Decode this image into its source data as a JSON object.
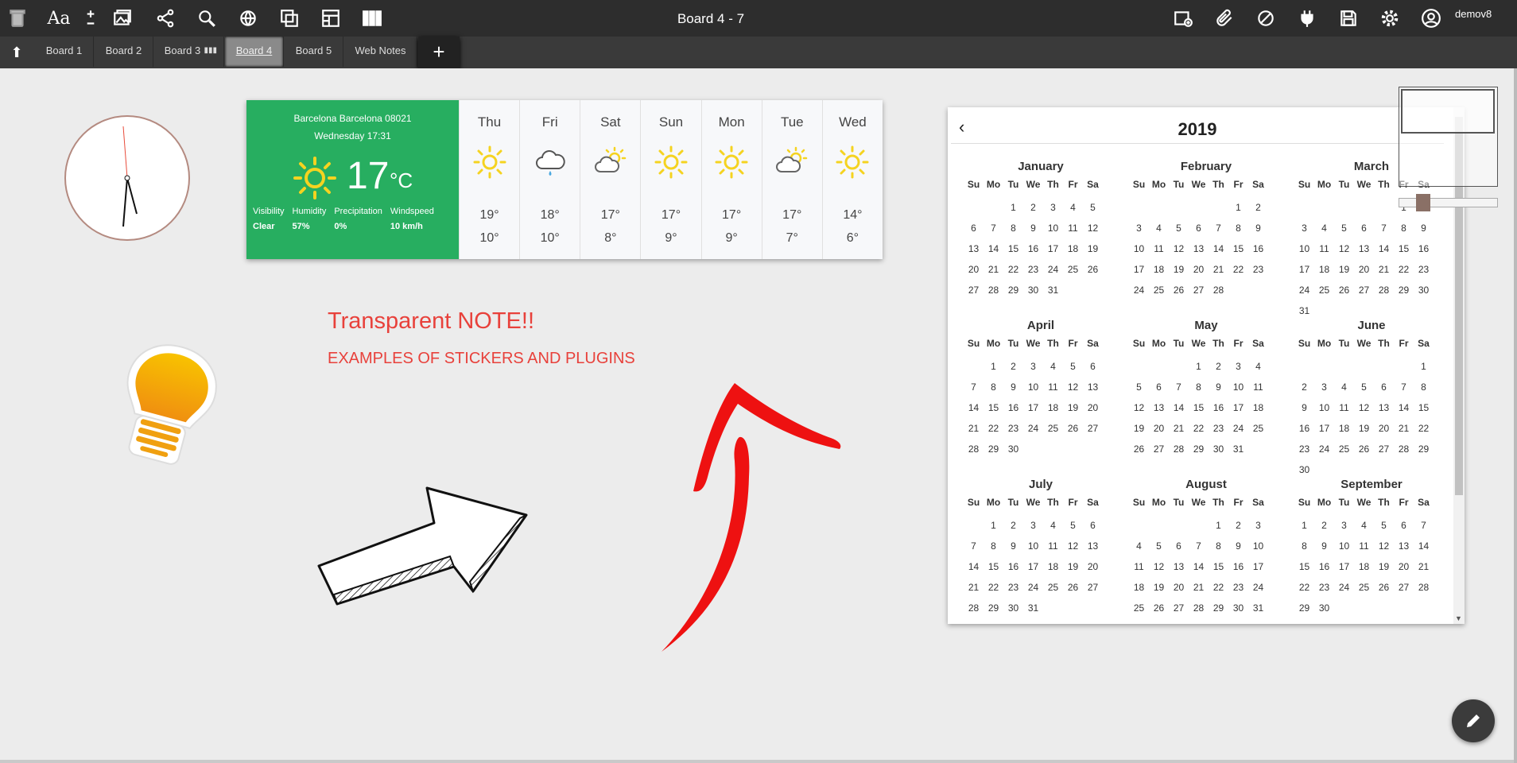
{
  "toolbar": {
    "title": "Board 4 - 7",
    "username": "demov8",
    "font_label": "Aa",
    "left_icons": [
      "trash-icon",
      "font-icon",
      "add-remove-icon",
      "image-icon",
      "share-icon",
      "search-icon",
      "web-icon",
      "windows-icon",
      "layout-icon",
      "columns-icon"
    ],
    "right_icons": [
      "add-note-icon",
      "attach-icon",
      "shape-icon",
      "plugin-icon",
      "save-icon",
      "settings-icon",
      "user-icon"
    ]
  },
  "tabs": [
    {
      "label": "Board 1",
      "active": false
    },
    {
      "label": "Board 2",
      "active": false
    },
    {
      "label": "Board 3",
      "active": false
    },
    {
      "label": "Board 4",
      "active": true
    },
    {
      "label": "Board 5",
      "active": false
    },
    {
      "label": "Web Notes",
      "active": false
    }
  ],
  "tab_add_label": "+",
  "weather": {
    "location": "Barcelona Barcelona 08021",
    "datetime": "Wednesday 17:31",
    "temp": "17",
    "unit": "°C",
    "stats": [
      {
        "label": "Visibility",
        "value": "Clear"
      },
      {
        "label": "Humidity",
        "value": "57%"
      },
      {
        "label": "Precipitation",
        "value": "0%"
      },
      {
        "label": "Windspeed",
        "value": "10 km/h"
      }
    ],
    "forecast": [
      {
        "day": "Thu",
        "icon": "sun",
        "high": "19°",
        "low": "10°"
      },
      {
        "day": "Fri",
        "icon": "rain",
        "high": "18°",
        "low": "10°"
      },
      {
        "day": "Sat",
        "icon": "partly-cloudy",
        "high": "17°",
        "low": "8°"
      },
      {
        "day": "Sun",
        "icon": "sun",
        "high": "17°",
        "low": "9°"
      },
      {
        "day": "Mon",
        "icon": "sun",
        "high": "17°",
        "low": "9°"
      },
      {
        "day": "Tue",
        "icon": "partly-cloudy",
        "high": "17°",
        "low": "7°"
      },
      {
        "day": "Wed",
        "icon": "sun",
        "high": "14°",
        "low": "6°"
      }
    ]
  },
  "note": {
    "title": "Transparent NOTE!!",
    "subtitle": "EXAMPLES OF STICKERS AND PLUGINS"
  },
  "calendar": {
    "year": "2019",
    "prev_label": "‹",
    "weekdays": [
      "Su",
      "Mo",
      "Tu",
      "We",
      "Th",
      "Fr",
      "Sa"
    ],
    "months": [
      {
        "name": "January",
        "offset": 2,
        "days": 31
      },
      {
        "name": "February",
        "offset": 5,
        "days": 28
      },
      {
        "name": "March",
        "offset": 5,
        "days": 31
      },
      {
        "name": "April",
        "offset": 1,
        "days": 30
      },
      {
        "name": "May",
        "offset": 3,
        "days": 31
      },
      {
        "name": "June",
        "offset": 6,
        "days": 30
      },
      {
        "name": "July",
        "offset": 1,
        "days": 31
      },
      {
        "name": "August",
        "offset": 4,
        "days": 31
      },
      {
        "name": "September",
        "offset": 0,
        "days": 30
      }
    ]
  },
  "colors": {
    "weather_green": "#27ae60",
    "note_red": "#e8413b",
    "arrow_red": "#ee1111",
    "toolbar_bg": "#2d2d2d",
    "sun_yellow": "#f5d320"
  }
}
